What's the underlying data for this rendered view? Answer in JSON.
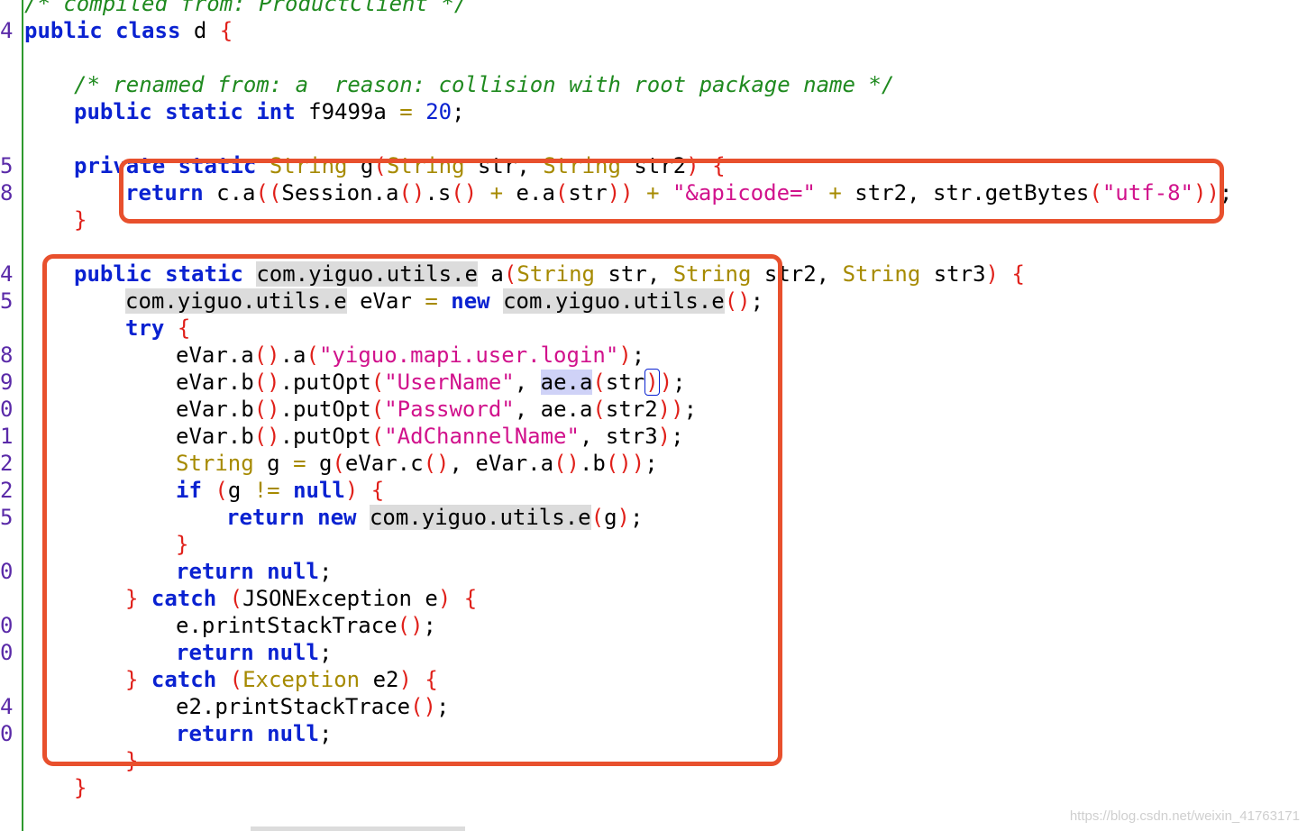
{
  "gutter": [
    "4",
    "5",
    "8",
    "4",
    "5",
    "8",
    "9",
    "0",
    "1",
    "2",
    "2",
    "5",
    "0",
    "0",
    "0",
    "4",
    "0"
  ],
  "code": {
    "l0": {
      "a": "/* compiled from: ProductClient */"
    },
    "l1": {
      "a": "public",
      "b": "class",
      "c": "d",
      "d": "{"
    },
    "l3": {
      "a": "/* renamed from: a  reason: collision with root package name */"
    },
    "l4": {
      "a": "public",
      "b": "static",
      "c": "int",
      "d": "f9499a",
      "e": "=",
      "f": "20",
      "g": ";"
    },
    "l6": {
      "a": "private",
      "b": "static",
      "c": "String",
      "d": "g",
      "e": "(",
      "f": "String",
      "g": "str,",
      "h": "String",
      "i": "str2",
      "j": ")",
      "k": "{"
    },
    "l7": {
      "a": "return",
      "b": "c.a",
      "c": "((",
      "d": "Session.a",
      "e": "()",
      "f": ".s",
      "g": "()",
      "h": "+",
      "i": "e.a",
      "j": "(",
      "k": "str",
      "l": "))",
      "m": "+",
      "n": "\"&apicode=\"",
      "o": "+",
      "p": "str2, str.getBytes",
      "q": "(",
      "r": "\"utf-8\"",
      "s": "))",
      "t": ";"
    },
    "l8": {
      "a": "}"
    },
    "l10": {
      "a": "public",
      "b": "static",
      "c": "com.yiguo.utils.e",
      "d": "a",
      "e": "(",
      "f": "String",
      "g": "str,",
      "h": "String",
      "i": "str2,",
      "j": "String",
      "k": "str3",
      "l": ")",
      "m": "{"
    },
    "l11": {
      "a": "com.yiguo.utils.e",
      "b": "eVar",
      "c": "=",
      "d": "new",
      "e": "com.yiguo.utils.e",
      "f": "()",
      "g": ";"
    },
    "l12": {
      "a": "try",
      "b": "{"
    },
    "l13": {
      "a": "eVar.a",
      "b": "()",
      "c": ".a",
      "d": "(",
      "e": "\"yiguo.mapi.user.login\"",
      "f": ")",
      "g": ";"
    },
    "l14": {
      "a": "eVar.b",
      "b": "()",
      "c": ".putOpt",
      "d": "(",
      "e": "\"UserName\"",
      "f": ",",
      "g": "ae.a",
      "h": "(",
      "i": "str",
      "j": ")",
      "k": ")",
      "l": ";"
    },
    "l15": {
      "a": "eVar.b",
      "b": "()",
      "c": ".putOpt",
      "d": "(",
      "e": "\"Password\"",
      "f": ",",
      "g": "ae.a",
      "h": "(",
      "i": "str2",
      "j": "))",
      "k": ";"
    },
    "l16": {
      "a": "eVar.b",
      "b": "()",
      "c": ".putOpt",
      "d": "(",
      "e": "\"AdChannelName\"",
      "f": ", str3",
      "g": ")",
      "h": ";"
    },
    "l17": {
      "a": "String",
      "b": "g",
      "c": "=",
      "d": "g",
      "e": "(",
      "f": "eVar.c",
      "g": "()",
      "h": ", eVar.a",
      "i": "()",
      "j": ".b",
      "k": "())",
      "l": ";"
    },
    "l18": {
      "a": "if",
      "b": "(",
      "c": "g",
      "d": "!=",
      "e": "null",
      "f": ")",
      "g": "{"
    },
    "l19": {
      "a": "return",
      "b": "new",
      "c": "com.yiguo.utils.e",
      "d": "(",
      "e": "g",
      "f": ")",
      "g": ";"
    },
    "l20": {
      "a": "}"
    },
    "l21": {
      "a": "return",
      "b": "null",
      "c": ";"
    },
    "l22": {
      "a": "}",
      "b": "catch",
      "c": "(",
      "d": "JSONException e",
      "e": ")",
      "f": "{"
    },
    "l23": {
      "a": "e.printStackTrace",
      "b": "()",
      "c": ";"
    },
    "l24": {
      "a": "return",
      "b": "null",
      "c": ";"
    },
    "l25": {
      "a": "}",
      "b": "catch",
      "c": "(",
      "d": "Exception",
      "e": "e2",
      "f": ")",
      "g": "{"
    },
    "l26": {
      "a": "e2.printStackTrace",
      "b": "()",
      "c": ";"
    },
    "l27": {
      "a": "return",
      "b": "null",
      "c": ";"
    },
    "l28": {
      "a": "}"
    },
    "l29": {
      "a": "}"
    }
  },
  "watermark": "https://blog.csdn.net/weixin_41763171",
  "colors": {
    "keyword": "#0a22d1",
    "type": "#a68a00",
    "string": "#d1128c",
    "comment": "#1f8a1f",
    "punctuation": "#e0201a",
    "gutter_number": "#5a2aa8",
    "highlight_box": "#e8502d",
    "usage_highlight": "#dcdcdc",
    "selection": "#cfd2f7"
  }
}
